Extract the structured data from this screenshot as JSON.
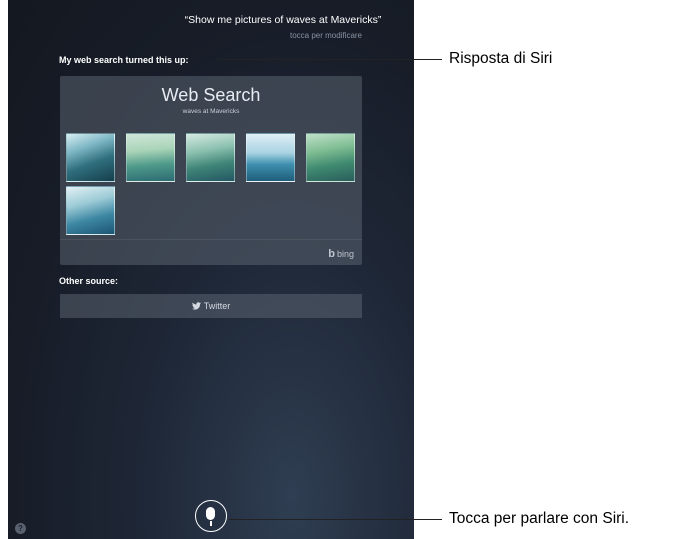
{
  "siri": {
    "query": "“Show me pictures of waves at Mavericks”",
    "edit_hint": "tocca per modificare",
    "web_search_label": "My web search turned this up:",
    "card_title": "Web Search",
    "card_subtitle": "waves at Mavericks",
    "provider": "bing",
    "provider_icon": "bing-logo-icon",
    "other_source_label": "Other source:",
    "twitter_label": "Twitter",
    "twitter_icon": "twitter-bird-icon",
    "mic_icon": "microphone-icon",
    "help_glyph": "?"
  },
  "callouts": {
    "response": "Risposta di Siri",
    "speak": "Tocca per parlare con Siri."
  },
  "colors": {
    "background": "#171c27",
    "card": "#4a5262",
    "text": "#ffffff"
  }
}
